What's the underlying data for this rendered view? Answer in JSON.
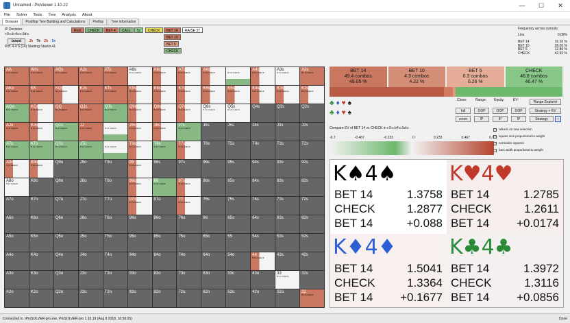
{
  "window": {
    "title": "Unnamed - PioViewer 1.10.22",
    "minimize": "—",
    "maximize": "☐",
    "close": "✕"
  },
  "menu": [
    "File",
    "Solver",
    "Tools",
    "Tree",
    "Analysis",
    "About"
  ],
  "tabs": [
    "Browser",
    "Postflop Tree Building and Calculations",
    "Preflop",
    "Tree information"
  ],
  "ip": {
    "decision": "IP Decision:",
    "path": "r:0:c:b:4s:c:3d:c",
    "board_label": "board",
    "board_cards": [
      "Jh",
      "Te",
      "2h",
      "5s"
    ],
    "pot": "Pot: 4 4 S (14) Starting Stacks:41"
  },
  "actions": {
    "root": "Root",
    "check": "CHECK",
    "bet4": "BET 4",
    "call": "CALL",
    "fivec": "5c",
    "check2": "CHECK",
    "bet14": "BET 14",
    "raise37": "RAISE 37",
    "bet10": "BET 10",
    "bet5": "BET 5",
    "check3": "CHECK"
  },
  "freq": {
    "title": "Frequency across runouts:",
    "line_label": "Line",
    "line_value": "0.09%",
    "rows": [
      {
        "a": "BET 14",
        "v": "16.16 %"
      },
      {
        "a": "BET 10",
        "v": "28.05 %"
      },
      {
        "a": "BET 5",
        "v": "12.86 %"
      },
      {
        "a": "CHECK",
        "v": "42.92 %"
      }
    ]
  },
  "grid": [
    [
      "AA",
      "AKs",
      "AQs",
      "AJs",
      "ATs",
      "A9s",
      "A8s",
      "A7s",
      "A6s",
      "A5s",
      "A4s",
      "A3s",
      "A2s"
    ],
    [
      "AKo",
      "KK",
      "KQs",
      "KJs",
      "KTs",
      "K9s",
      "K8s",
      "K7s",
      "K6s",
      "K5s",
      "K4s",
      "K3s",
      "K2s"
    ],
    [
      "AQo",
      "KQo",
      "QQ",
      "QJs",
      "QTs",
      "Q9s",
      "Q8s",
      "Q7s",
      "Q6s",
      "Q5s",
      "Q4s",
      "Q3s",
      "Q2s"
    ],
    [
      "AJo",
      "KJo",
      "QJo",
      "JJ",
      "JTs",
      "J9s",
      "J8s",
      "J7s",
      "J6s",
      "J5s",
      "J4s",
      "J3s",
      "J2s"
    ],
    [
      "ATo",
      "KTo",
      "QTo",
      "JTo",
      "TT",
      "T9s",
      "T8s",
      "T7s",
      "T6s",
      "T5s",
      "T4s",
      "T3s",
      "T2s"
    ],
    [
      "A9o",
      "K9o",
      "Q9o",
      "J9o",
      "T9o",
      "99",
      "98s",
      "97s",
      "96s",
      "95s",
      "94s",
      "93s",
      "92s"
    ],
    [
      "A8o",
      "K8o",
      "Q8o",
      "J8o",
      "T8o",
      "98o",
      "88",
      "87s",
      "86s",
      "85s",
      "84s",
      "83s",
      "82s"
    ],
    [
      "A7o",
      "K7o",
      "Q7o",
      "J7o",
      "T7o",
      "97o",
      "87o",
      "77",
      "76s",
      "75s",
      "74s",
      "73s",
      "72s"
    ],
    [
      "A6o",
      "K6o",
      "Q6o",
      "J6o",
      "T6o",
      "96o",
      "86o",
      "76o",
      "66",
      "65s",
      "64s",
      "63s",
      "62s"
    ],
    [
      "A5o",
      "K5o",
      "Q5o",
      "J5o",
      "T5o",
      "95o",
      "85o",
      "75o",
      "65o",
      "55",
      "54s",
      "53s",
      "52s"
    ],
    [
      "A4o",
      "K4o",
      "Q4o",
      "J4o",
      "T4o",
      "94o",
      "84o",
      "74o",
      "64o",
      "54o",
      "44",
      "43s",
      "42s"
    ],
    [
      "A3o",
      "K3o",
      "Q3o",
      "J3o",
      "T3o",
      "93o",
      "83o",
      "73o",
      "63o",
      "53o",
      "43o",
      "33",
      "32s"
    ],
    [
      "A2o",
      "K2o",
      "Q2o",
      "J2o",
      "T2o",
      "92o",
      "82o",
      "72o",
      "62o",
      "52o",
      "42o",
      "32o",
      "22"
    ]
  ],
  "mini": {
    "b14": "B 14",
    "chk": "CHECK"
  },
  "range": [
    {
      "a": "BET 14",
      "c": "49.4 combos",
      "p": "49.05 %"
    },
    {
      "a": "BET 10",
      "c": "4.3 combos",
      "p": "4.22 %"
    },
    {
      "a": "BET 5",
      "c": "0.3 combos",
      "p": "0.26 %"
    },
    {
      "a": "CHECK",
      "c": "46.8 combos",
      "p": "46.47 %"
    }
  ],
  "controls": {
    "clone": "Clone:",
    "range": "Range:",
    "equity": "Equity:",
    "ev": "EV:",
    "full": "full",
    "zoom": "zoom",
    "oop": "OOP",
    "ip": "IP",
    "range_explorer": "Range Explorer",
    "strategy_ev": "Strategy + EV",
    "strategy": "Strategy",
    "plus": "+"
  },
  "compare": "Compare EV of BET 14 vs CHECK in r:0:c:b4:c:5d:c",
  "scale": [
    "-0.7",
    "-0.467",
    "-0.233",
    "0",
    "0.233",
    "0.467",
    "0.7"
  ],
  "checks": [
    "refresh on new selection",
    "square size proportional to weight",
    "normalize squares",
    "bars width proportional to weight"
  ],
  "details": [
    {
      "rank": "K",
      "suit": "♠",
      "rank2": "4",
      "suit2": "♠",
      "color": "#000000",
      "bg": "#ffffff",
      "rows": [
        [
          "BET 14",
          "1.3758"
        ],
        [
          "CHECK",
          "1.2877"
        ],
        [
          "BET 14",
          "+0.088"
        ]
      ]
    },
    {
      "rank": "K",
      "suit": "♥",
      "rank2": "4",
      "suit2": "♥",
      "color": "#c0392b",
      "bg": "#f6eded",
      "rows": [
        [
          "BET 14",
          "1.2785"
        ],
        [
          "CHECK",
          "1.2611"
        ],
        [
          "BET 14",
          "+0.0174"
        ]
      ]
    },
    {
      "rank": "K",
      "suit": "♦",
      "rank2": "4",
      "suit2": "♦",
      "color": "#2c5fd4",
      "bg": "#f8f0ee",
      "rows": [
        [
          "BET 14",
          "1.5041"
        ],
        [
          "CHECK",
          "1.3364"
        ],
        [
          "BET 14",
          "+0.1677"
        ]
      ]
    },
    {
      "rank": "K",
      "suit": "♣",
      "rank2": "4",
      "suit2": "♣",
      "color": "#2a8c3a",
      "bg": "#f4f0ef",
      "rows": [
        [
          "BET 14",
          "1.3972"
        ],
        [
          "CHECK",
          "1.3116"
        ],
        [
          "BET 14",
          "+0.0856"
        ]
      ]
    }
  ],
  "status": {
    "left": "Connected to .\\PioSOLVER-pro.exe, PioSOLVER-pro 1.10.19 (Aug  8 2018, 10:58:25)",
    "right": "Done"
  }
}
